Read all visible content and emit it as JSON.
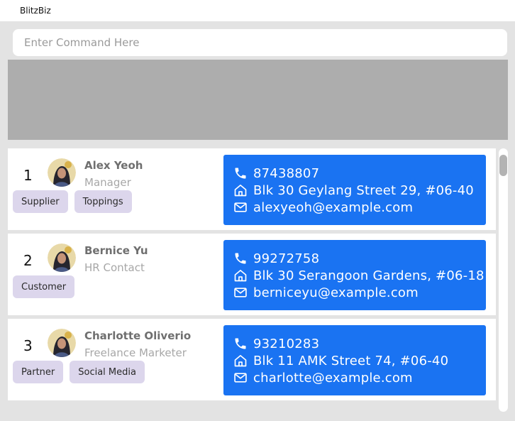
{
  "app": {
    "title": "BlitzBiz"
  },
  "command": {
    "placeholder": "Enter Command Here",
    "value": ""
  },
  "contacts": [
    {
      "index": "1",
      "name": "Alex Yeoh",
      "role": "Manager",
      "tags": [
        "Supplier",
        "Toppings"
      ],
      "phone": "87438807",
      "address": "Blk 30 Geylang Street 29, #06-40",
      "email": "alexyeoh@example.com"
    },
    {
      "index": "2",
      "name": "Bernice Yu",
      "role": "HR Contact",
      "tags": [
        "Customer"
      ],
      "phone": "99272758",
      "address": "Blk 30 Serangoon Gardens, #06-18",
      "email": "berniceyu@example.com"
    },
    {
      "index": "3",
      "name": "Charlotte Oliverio",
      "role": "Freelance Marketer",
      "tags": [
        "Partner",
        "Social Media"
      ],
      "phone": "93210283",
      "address": "Blk 11 AMK Street 74, #06-40",
      "email": "charlotte@example.com"
    }
  ],
  "colors": {
    "info_card": "#1a73f2",
    "tag": "#dcd6ec",
    "result_box": "#adadad"
  },
  "icons": {
    "phone": "phone-icon",
    "address": "home-icon",
    "email": "mail-icon",
    "avatar": "avatar"
  }
}
